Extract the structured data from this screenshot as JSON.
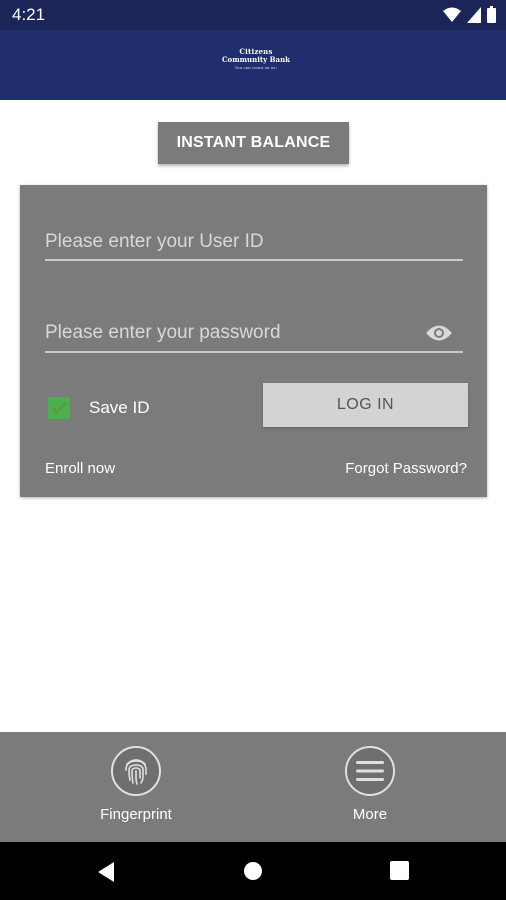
{
  "status_bar": {
    "time": "4:21",
    "icons": [
      "wifi-icon",
      "signal-icon",
      "battery-icon"
    ]
  },
  "header": {
    "logo_line1": "Citizens",
    "logo_line2": "Community Bank",
    "logo_tagline": "You can count on us!"
  },
  "instant_balance": {
    "label": "INSTANT BALANCE"
  },
  "login": {
    "user_id_placeholder": "Please enter your User ID",
    "password_placeholder": "Please enter your password",
    "save_id_label": "Save ID",
    "save_id_checked": true,
    "login_label": "LOG IN",
    "enroll_label": "Enroll now",
    "forgot_label": "Forgot Password?"
  },
  "bottom_nav": {
    "fingerprint_label": "Fingerprint",
    "more_label": "More"
  },
  "colors": {
    "header_bg": "#212e6d",
    "panel_gray": "#7b7b7b",
    "checkbox_green": "#4caf50",
    "button_light": "#d3d3d3"
  }
}
